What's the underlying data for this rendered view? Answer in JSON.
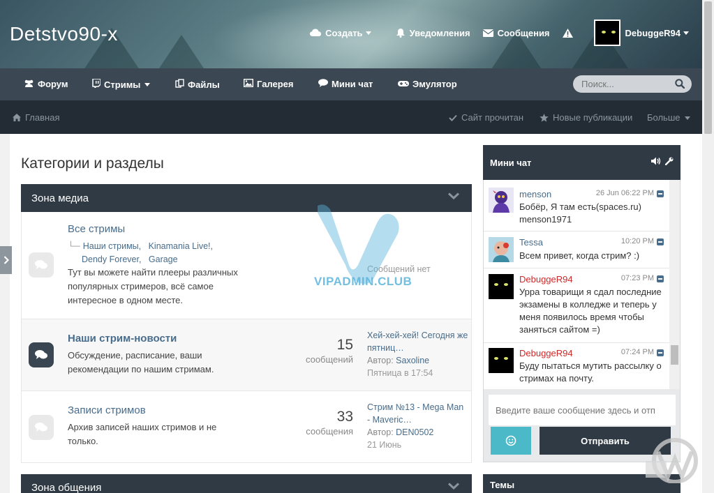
{
  "header": {
    "site_title": "Detstvo90-x",
    "create_label": "Создать",
    "notifications_label": "Уведомления",
    "messages_label": "Сообщения",
    "username": "DebuggeR94"
  },
  "mainnav": {
    "items": [
      {
        "label": "Форум",
        "icon": "users-icon"
      },
      {
        "label": "Стримы",
        "icon": "twitch-icon"
      },
      {
        "label": "Файлы",
        "icon": "files-icon"
      },
      {
        "label": "Галерея",
        "icon": "image-icon"
      },
      {
        "label": "Мини чат",
        "icon": "chat-icon"
      },
      {
        "label": "Эмулятор",
        "icon": "gamepad-icon"
      }
    ],
    "search_placeholder": "Поиск..."
  },
  "subnav": {
    "home": "Главная",
    "mark_read": "Сайт прочитан",
    "new_posts": "Новые публикации",
    "more": "Больше"
  },
  "main": {
    "page_title": "Категории и разделы",
    "categories": [
      {
        "title": "Зона медиа"
      },
      {
        "title": "Зона общения"
      }
    ],
    "forums": [
      {
        "title": "Все стримы",
        "subforums": [
          "Наши стримы,",
          "Kinamania Live!,",
          "Dendy Forever,",
          "Garage"
        ],
        "desc": "Тут вы можете найти плееры различных популярных стримеров, всё самое интересное в одном месте.",
        "no_messages": "Сообщений нет"
      },
      {
        "title": "Наши стрим-новости",
        "desc": "Обсуждение, расписание, ваши рекомендации по нашим стримам.",
        "count": "15",
        "count_label": "сообщений",
        "last_title": "Хей-хей-хей! Сегодня же пятниц…",
        "last_author_label": "Автор:",
        "last_author": "Saxoline",
        "last_time": "Пятница в 17:54"
      },
      {
        "title": "Записи стримов",
        "desc": "Архив записей наших стримов и не только.",
        "count": "33",
        "count_label": "сообщения",
        "last_title": "Стрим №13 - Mega Man - Maveric…",
        "last_author_label": "Автор:",
        "last_author": "DEN0502",
        "last_time": "21 Июнь"
      }
    ],
    "watermark": "VIPADMIN.CLUB"
  },
  "chat": {
    "title": "Мини чат",
    "messages": [
      {
        "name": "menson",
        "time": "26 Jun 06:22 PM",
        "text": "Бобёр, Я там есть(spaces.ru) menson1971",
        "red": false
      },
      {
        "name": "Tessa",
        "time": "10:20 PM",
        "text": "Всем привет, когда стрим? :)",
        "red": false
      },
      {
        "name": "DebuggeR94",
        "time": "07:23 PM",
        "text": "Урра товарищи я сдал последние экзамены в колледже и теперь у меня появилось время чтобы заняться сайтом =)",
        "red": true
      },
      {
        "name": "DebuggeR94",
        "time": "07:24 PM",
        "text": "Буду пытаться мутить рассылку о стримах на почту.",
        "red": true
      }
    ],
    "input_placeholder": "Введите ваше сообщение здесь и отп",
    "send_label": "Отправить"
  },
  "sidebar": {
    "topics_title": "Темы"
  },
  "colors": {
    "header_dark": "#2f3a44",
    "nav": "#3b4854",
    "subnav": "#232c35",
    "link": "#486c8b",
    "accent": "#4bb9c7",
    "username_red": "#d02828"
  }
}
